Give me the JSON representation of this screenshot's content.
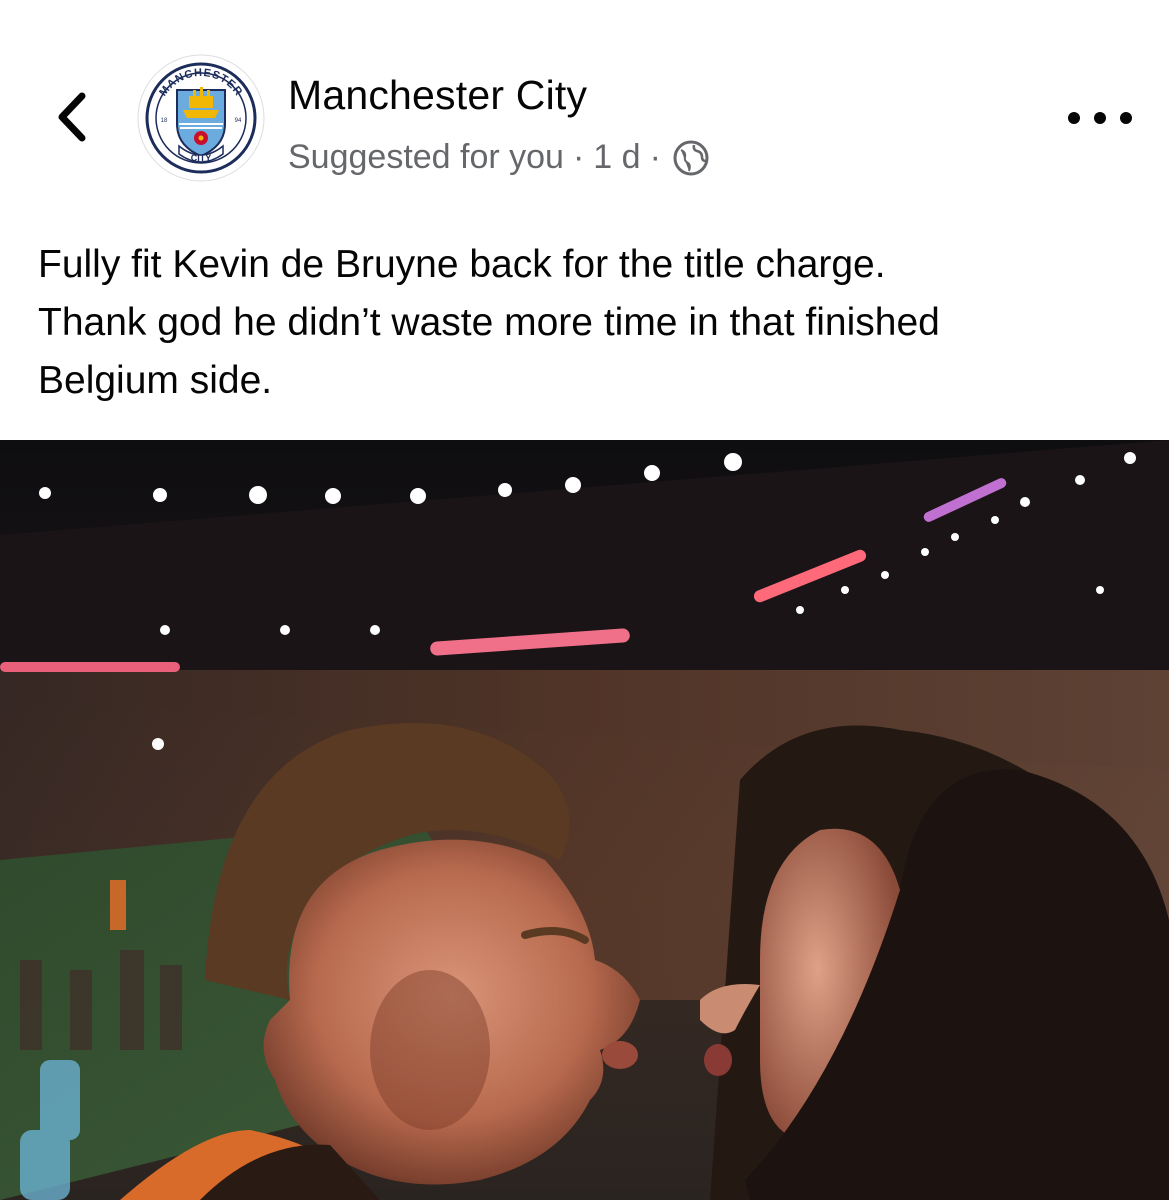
{
  "post": {
    "page_name": "Manchester City",
    "suggested": "Suggested for you",
    "separator": "·",
    "time": "1 d",
    "caption_lines": [
      "Fully fit Kevin de Bruyne back for the title charge.",
      "Thank god he didn’t waste more time in that finished",
      "Belgium side."
    ]
  },
  "logo": {
    "top_text": "MANCHESTER",
    "bottom_text": "CITY",
    "left_year": "18",
    "right_year": "94",
    "colors": {
      "ring": "#6cabdd",
      "navy": "#1c2c5b",
      "gold": "#f2b705",
      "red": "#c8102e"
    }
  },
  "icons": {
    "back": "chevron-left-icon",
    "audience": "globe-icon",
    "more": "more-horizontal-icon"
  },
  "colors": {
    "text": "#050505",
    "secondary": "#65676b"
  }
}
